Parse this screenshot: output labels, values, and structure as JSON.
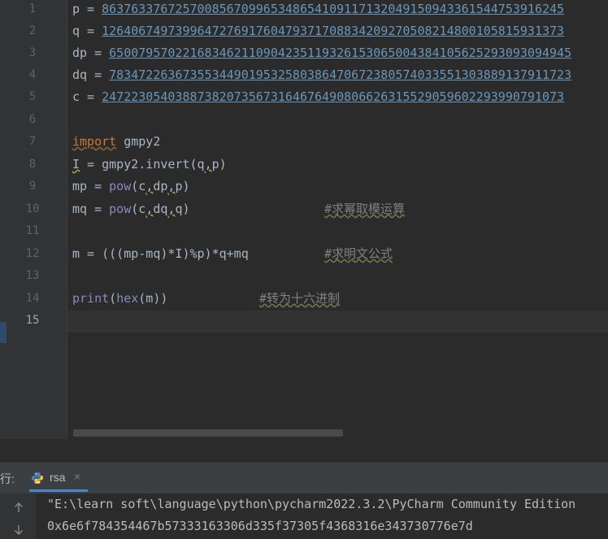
{
  "editor": {
    "line_numbers": [
      "1",
      "2",
      "3",
      "4",
      "5",
      "6",
      "7",
      "8",
      "9",
      "10",
      "11",
      "12",
      "13",
      "14",
      "15"
    ],
    "current_line": 15,
    "lines": {
      "l1": {
        "var": "p",
        "op": " = ",
        "num": "863763376725700856709965348654109117132049150943361544753916245"
      },
      "l2": {
        "var": "q",
        "op": " = ",
        "num": "126406749739964727691760479371708834209270508214800105815931373"
      },
      "l3": {
        "var": "dp",
        "op": " = ",
        "num": "650079570221683462110904235119326153065004384105625293093094945"
      },
      "l4": {
        "var": "dq",
        "op": " = ",
        "num": "783472263673553449019532580386470672380574033551303889137911723"
      },
      "l5": {
        "var": "c",
        "op": " = ",
        "num": "247223054038873820735673164676490806626315529059602293990791073"
      },
      "l7": {
        "kw": "import",
        "rest": " gmpy2"
      },
      "l8": {
        "var": "I",
        "mid": " = gmpy2.invert(q",
        "comma": ",",
        "tail": "p)"
      },
      "l9": {
        "lhs": "mp = ",
        "fn": "pow",
        "a": "(c",
        "c1": ",",
        "b": "dp",
        "c2": ",",
        "tail": "p)"
      },
      "l10": {
        "lhs": "mq = ",
        "fn": "pow",
        "a": "(c",
        "c1": ",",
        "b": "dq",
        "c2": ",",
        "tail": "q)",
        "comment": "#求幂取模运算"
      },
      "l12": {
        "code": "m = (((mp-mq)*I)%p)*q+mq",
        "comment": "#求明文公式"
      },
      "l14": {
        "fn1": "print",
        "p1": "(",
        "fn2": "hex",
        "p2": "(m))",
        "comment": "#转为十六进制"
      }
    }
  },
  "run_panel": {
    "label": "行:",
    "tab_label": "rsa",
    "tab_close": "×",
    "output_lines": [
      "\"E:\\learn soft\\language\\python\\pycharm2022.3.2\\PyCharm Community Edition",
      "0x6e6f784354467b57333163306d335f37305f4368316e343730776e7d"
    ]
  },
  "colors": {
    "background": "#2b2b2b",
    "keyword": "#cc7832",
    "number": "#6897bb",
    "builtin": "#8888c6",
    "comment": "#808080",
    "accent": "#4a88c7"
  }
}
